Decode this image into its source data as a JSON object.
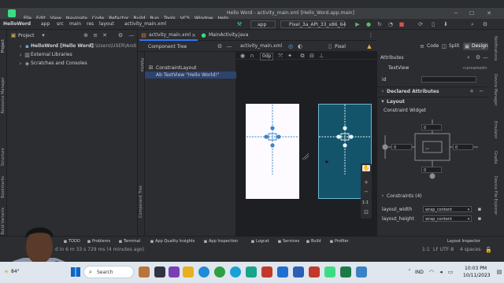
{
  "window": {
    "project": "HelloWord",
    "crumbs": [
      "app",
      "src",
      "main",
      "res",
      "layout"
    ],
    "file": "activity_main.xml",
    "title": "Hello Word - activity_main.xml [Hello_Word.app.main]"
  },
  "menu": [
    "File",
    "Edit",
    "View",
    "Navigate",
    "Code",
    "Refactor",
    "Build",
    "Run",
    "Tools",
    "VCS",
    "Window",
    "Help"
  ],
  "toolbar": {
    "run_config": "app",
    "device": "Pixel_3a_API_33_x86_64"
  },
  "project_panel": {
    "title": "Project",
    "tree": [
      {
        "label": "HelloWord [Hello Word]",
        "path": "C:\\Users\\USER\\Android"
      },
      {
        "label": "External Libraries",
        "path": ""
      },
      {
        "label": "Scratches and Consoles",
        "path": ""
      }
    ]
  },
  "editor_tabs": [
    {
      "label": "activity_main.xml",
      "active": true
    },
    {
      "label": "MainActivity.java",
      "active": false
    }
  ],
  "view_modes": [
    "Code",
    "Split",
    "Design"
  ],
  "palette_label": "Palette",
  "component_tree": {
    "title": "Component Tree",
    "side_label": "Component Tree",
    "items": [
      "ConstraintLayout",
      "Ab TextView \"Hello World!\""
    ]
  },
  "design_toolbar": {
    "file": "activity_main.xml",
    "device": "Pixel",
    "margin": "0dp"
  },
  "preview": {
    "textview_label": "Hello World!",
    "blueprint_color": "#13546b"
  },
  "zoom_controls": {
    "ratio": "1:1"
  },
  "attributes": {
    "title": "Attributes",
    "widget": "TextView",
    "unnamed": "<unnamed>",
    "id_label": "id",
    "declared": "Declared Attributes",
    "layout_section": "Layout",
    "constraint_widget": "Constraint Widget",
    "margins": {
      "top": "0",
      "left": "0",
      "right": "0",
      "bottom": "0"
    },
    "constraints": "Constraints (4)",
    "layout_width_label": "layout_width",
    "layout_width": "wrap_content",
    "layout_height_label": "layout_height",
    "layout_height": "wrap_content"
  },
  "left_strip": [
    "Project",
    "Resource Manager",
    "Structure",
    "Bookmarks",
    "Build Variants"
  ],
  "right_strip": [
    "Notifications",
    "Device Manager",
    "Emulator",
    "Gradle",
    "Device File Explorer"
  ],
  "bottom_tools": [
    "TODO",
    "Problems",
    "Terminal",
    "App Quality Insights",
    "App Inspection",
    "Logcat",
    "Services",
    "Build",
    "Profiler"
  ],
  "layout_inspector": "Layout Inspector",
  "status": {
    "message": "d in 6 m 33 s 729 ms (4 minutes ago)",
    "position": "1:1",
    "encoding": "LF  UTF-8",
    "indent": "4 spaces"
  },
  "taskbar": {
    "search": "Search",
    "weather": "84°",
    "lang": "IND",
    "time": "10:03 PM",
    "date": "10/11/2023"
  }
}
